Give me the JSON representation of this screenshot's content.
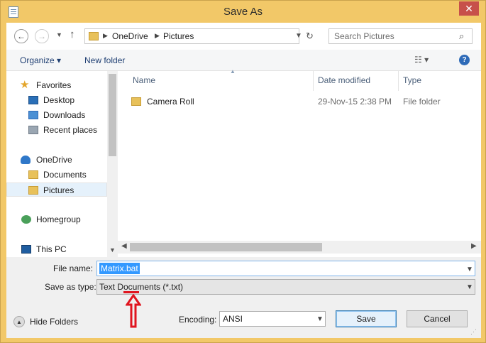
{
  "window": {
    "title": "Save As"
  },
  "address": {
    "crumbs": [
      "OneDrive",
      "Pictures"
    ]
  },
  "search": {
    "placeholder": "Search Pictures"
  },
  "commands": {
    "organize": "Organize ▾",
    "new_folder": "New folder"
  },
  "nav": {
    "favorites": "Favorites",
    "items": [
      "Desktop",
      "Downloads",
      "Recent places"
    ],
    "onedrive": "OneDrive",
    "onedrive_items": [
      "Documents",
      "Pictures"
    ],
    "homegroup": "Homegroup",
    "this_pc": "This PC"
  },
  "columns": {
    "name": "Name",
    "date": "Date modified",
    "type": "Type"
  },
  "files": [
    {
      "name": "Camera Roll",
      "date": "29-Nov-15 2:38 PM",
      "type": "File folder"
    }
  ],
  "form": {
    "filename_label": "File name:",
    "filename_value": "Matrix.bat",
    "savetype_label": "Save as type:",
    "savetype_value": "Text Documents (*.txt)",
    "encoding_label": "Encoding:",
    "encoding_value": "ANSI",
    "hide_folders": "Hide Folders",
    "save": "Save",
    "cancel": "Cancel"
  },
  "annotation_color": "#e0141e"
}
